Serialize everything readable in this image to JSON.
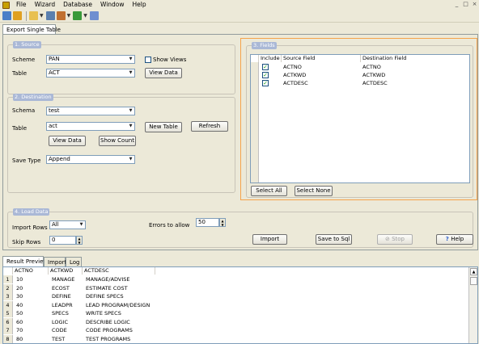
{
  "menu": [
    "File",
    "Wizard",
    "Database",
    "Window",
    "Help"
  ],
  "window_controls": [
    "_",
    "□",
    "×"
  ],
  "tabs": {
    "main": "Export Single Table",
    "bottom": [
      "Result Preview",
      "Import",
      "Log"
    ]
  },
  "source": {
    "legend": "1. Source",
    "scheme_label": "Scheme",
    "scheme_value": "PAN",
    "table_label": "Table",
    "table_value": "ACT",
    "show_views": "Show Views",
    "view_data": "View Data"
  },
  "destination": {
    "legend": "2. Destination",
    "schema_label": "Schema",
    "schema_value": "test",
    "table_label": "Table",
    "table_value": "act",
    "new_table": "New Table",
    "refresh": "Refresh",
    "view_data": "View Data",
    "show_count": "Show Count",
    "save_type_label": "Save Type",
    "save_type_value": "Append"
  },
  "fields": {
    "legend": "3. Fields",
    "columns": [
      "Include",
      "Source Field",
      "Destination Field"
    ],
    "rows": [
      [
        "ACTNO",
        "ACTNO"
      ],
      [
        "ACTKWD",
        "ACTKWD"
      ],
      [
        "ACTDESC",
        "ACTDESC"
      ]
    ],
    "select_all": "Select All",
    "select_none": "Select None"
  },
  "load": {
    "legend": "4. Load Data",
    "import_rows_label": "Import Rows",
    "import_rows_value": "All",
    "skip_rows_label": "Skip Rows",
    "skip_rows_value": "0",
    "errors_label": "Errors to allow",
    "errors_value": "50",
    "import": "Import",
    "save_to_sql": "Save to Sql",
    "stop": "Stop",
    "help": "Help"
  },
  "preview": {
    "columns": [
      "ACTNO",
      "ACTKWD",
      "ACTDESC"
    ],
    "rows": [
      [
        "1",
        "10",
        "MANAGE",
        "MANAGE/ADVISE"
      ],
      [
        "2",
        "20",
        "ECOST",
        "ESTIMATE COST"
      ],
      [
        "3",
        "30",
        "DEFINE",
        "DEFINE SPECS"
      ],
      [
        "4",
        "40",
        "LEADPR",
        "LEAD PROGRAM/DESIGN"
      ],
      [
        "5",
        "50",
        "SPECS",
        "WRITE SPECS"
      ],
      [
        "6",
        "60",
        "LOGIC",
        "DESCRIBE LOGIC"
      ],
      [
        "7",
        "70",
        "CODE",
        "CODE PROGRAMS"
      ],
      [
        "8",
        "80",
        "TEST",
        "TEST PROGRAMS"
      ]
    ]
  },
  "colors": {
    "highlight": "#f5a34a",
    "legend_bg": "#aab8d6",
    "check": "#21a121"
  }
}
